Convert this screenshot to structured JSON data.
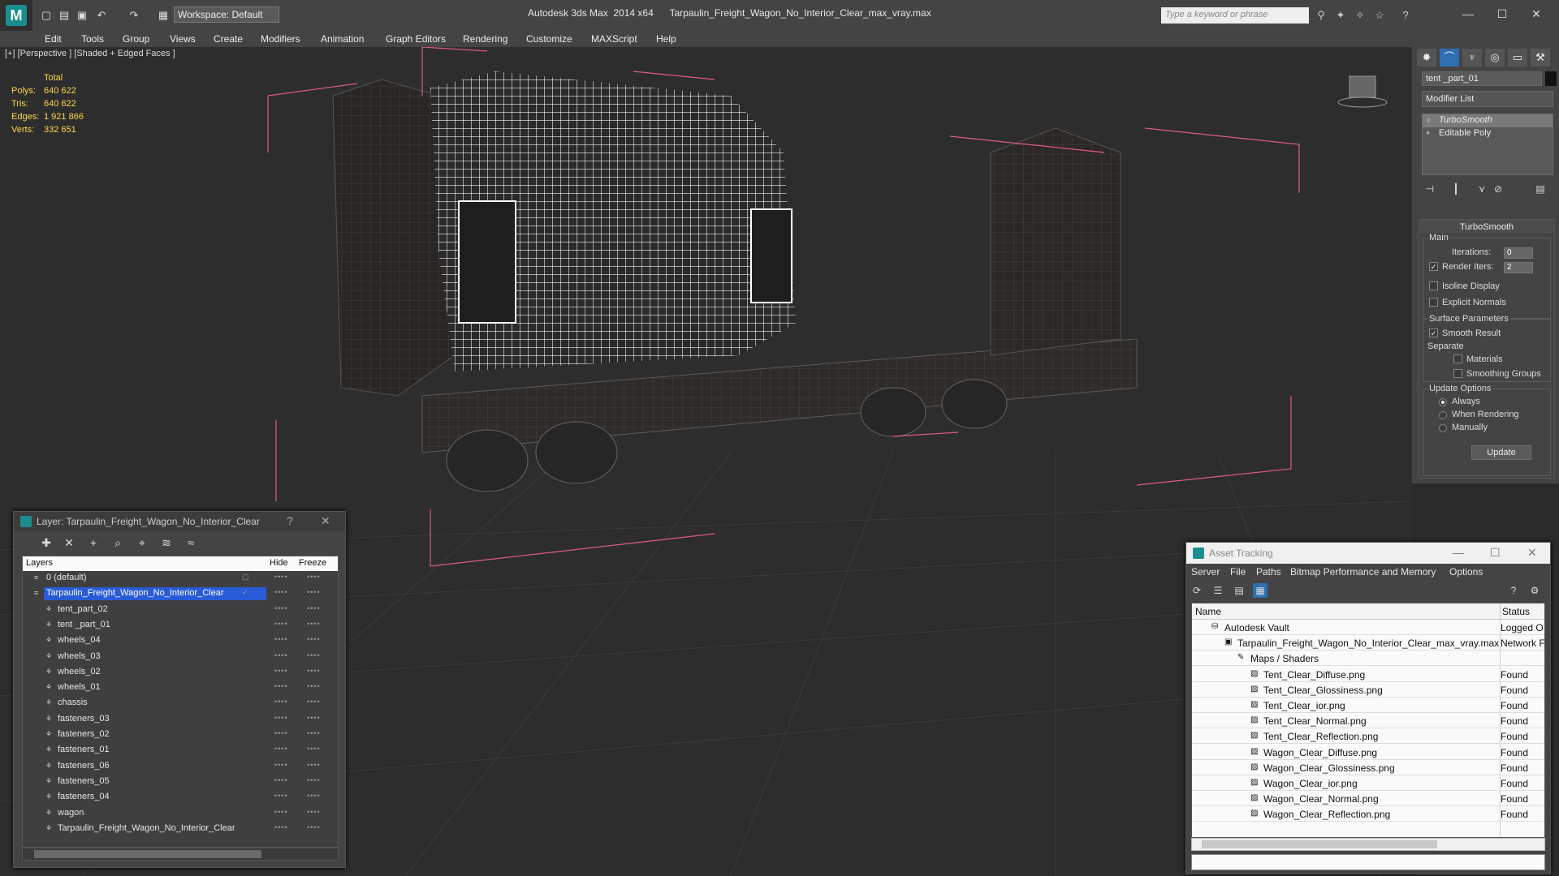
{
  "app": {
    "title": "Autodesk 3ds Max  2014 x64",
    "file": "Tarpaulin_Freight_Wagon_No_Interior_Clear_max_vray.max",
    "workspace": "Workspace: Default",
    "search_placeholder": "Type a keyword or phrase"
  },
  "menu": [
    "Edit",
    "Tools",
    "Group",
    "Views",
    "Create",
    "Modifiers",
    "Animation",
    "Graph Editors",
    "Rendering",
    "Customize",
    "MAXScript",
    "Help"
  ],
  "viewport": {
    "label": "[+] [Perspective ] [Shaded + Edged Faces ]",
    "stats": {
      "header": "Total",
      "rows": [
        {
          "k": "Polys:",
          "v": "640 622"
        },
        {
          "k": "Tris:",
          "v": "640 622"
        },
        {
          "k": "Edges:",
          "v": "1 921 866"
        },
        {
          "k": "Verts:",
          "v": "332 651"
        }
      ]
    }
  },
  "command_panel": {
    "object_name": "tent _part_01",
    "modifier_list": "Modifier List",
    "stack": [
      "TurboSmooth",
      "Editable Poly"
    ],
    "rollout": {
      "title": "TurboSmooth",
      "main": "Main",
      "iterations_label": "Iterations:",
      "iterations": "0",
      "render_iters_label": "Render Iters:",
      "render_iters": "2",
      "isoline": "Isoline Display",
      "explicit": "Explicit Normals",
      "surface": "Surface Parameters",
      "smooth_result": "Smooth Result",
      "separate": "Separate",
      "materials": "Materials",
      "smoothing_groups": "Smoothing Groups",
      "update_options": "Update Options",
      "always": "Always",
      "when_rendering": "When Rendering",
      "manually": "Manually",
      "update": "Update"
    }
  },
  "layer_window": {
    "title": "Layer: Tarpaulin_Freight_Wagon_No_Interior_Clear",
    "help": "?",
    "columns": {
      "layers": "Layers",
      "hide": "Hide",
      "freeze": "Freeze"
    },
    "rows": [
      {
        "name": "0 (default)",
        "level": 0
      },
      {
        "name": "Tarpaulin_Freight_Wagon_No_Interior_Clear",
        "level": 0
      },
      {
        "name": "tent_part_02",
        "level": 1
      },
      {
        "name": "tent _part_01",
        "level": 1
      },
      {
        "name": "wheels_04",
        "level": 1
      },
      {
        "name": "wheels_03",
        "level": 1
      },
      {
        "name": "wheels_02",
        "level": 1
      },
      {
        "name": "wheels_01",
        "level": 1
      },
      {
        "name": "chassis",
        "level": 1
      },
      {
        "name": "fasteners_03",
        "level": 1
      },
      {
        "name": "fasteners_02",
        "level": 1
      },
      {
        "name": "fasteners_01",
        "level": 1
      },
      {
        "name": "fasteners_06",
        "level": 1
      },
      {
        "name": "fasteners_05",
        "level": 1
      },
      {
        "name": "fasteners_04",
        "level": 1
      },
      {
        "name": "wagon",
        "level": 1
      },
      {
        "name": "Tarpaulin_Freight_Wagon_No_Interior_Clear",
        "level": 1
      }
    ]
  },
  "asset_window": {
    "title": "Asset Tracking",
    "menu": [
      "Server",
      "File",
      "Paths",
      "Bitmap Performance and Memory",
      "Options"
    ],
    "columns": {
      "name": "Name",
      "status": "Status"
    },
    "rows": [
      {
        "name": "Autodesk Vault",
        "status": "Logged O",
        "level": 0
      },
      {
        "name": "Tarpaulin_Freight_Wagon_No_Interior_Clear_max_vray.max",
        "status": "Network F",
        "level": 1
      },
      {
        "name": "Maps / Shaders",
        "status": "",
        "level": 2
      },
      {
        "name": "Tent_Clear_Diffuse.png",
        "status": "Found",
        "level": 3
      },
      {
        "name": "Tent_Clear_Glossiness.png",
        "status": "Found",
        "level": 3
      },
      {
        "name": "Tent_Clear_ior.png",
        "status": "Found",
        "level": 3
      },
      {
        "name": "Tent_Clear_Normal.png",
        "status": "Found",
        "level": 3
      },
      {
        "name": "Tent_Clear_Reflection.png",
        "status": "Found",
        "level": 3
      },
      {
        "name": "Wagon_Clear_Diffuse.png",
        "status": "Found",
        "level": 3
      },
      {
        "name": "Wagon_Clear_Glossiness.png",
        "status": "Found",
        "level": 3
      },
      {
        "name": "Wagon_Clear_ior.png",
        "status": "Found",
        "level": 3
      },
      {
        "name": "Wagon_Clear_Normal.png",
        "status": "Found",
        "level": 3
      },
      {
        "name": "Wagon_Clear_Reflection.png",
        "status": "Found",
        "level": 3
      }
    ]
  },
  "colors": {
    "accent": "#1b8d8f",
    "selection": "#2a5bd7",
    "stats": "#ffd84a",
    "bbox": "#e05a8a"
  }
}
